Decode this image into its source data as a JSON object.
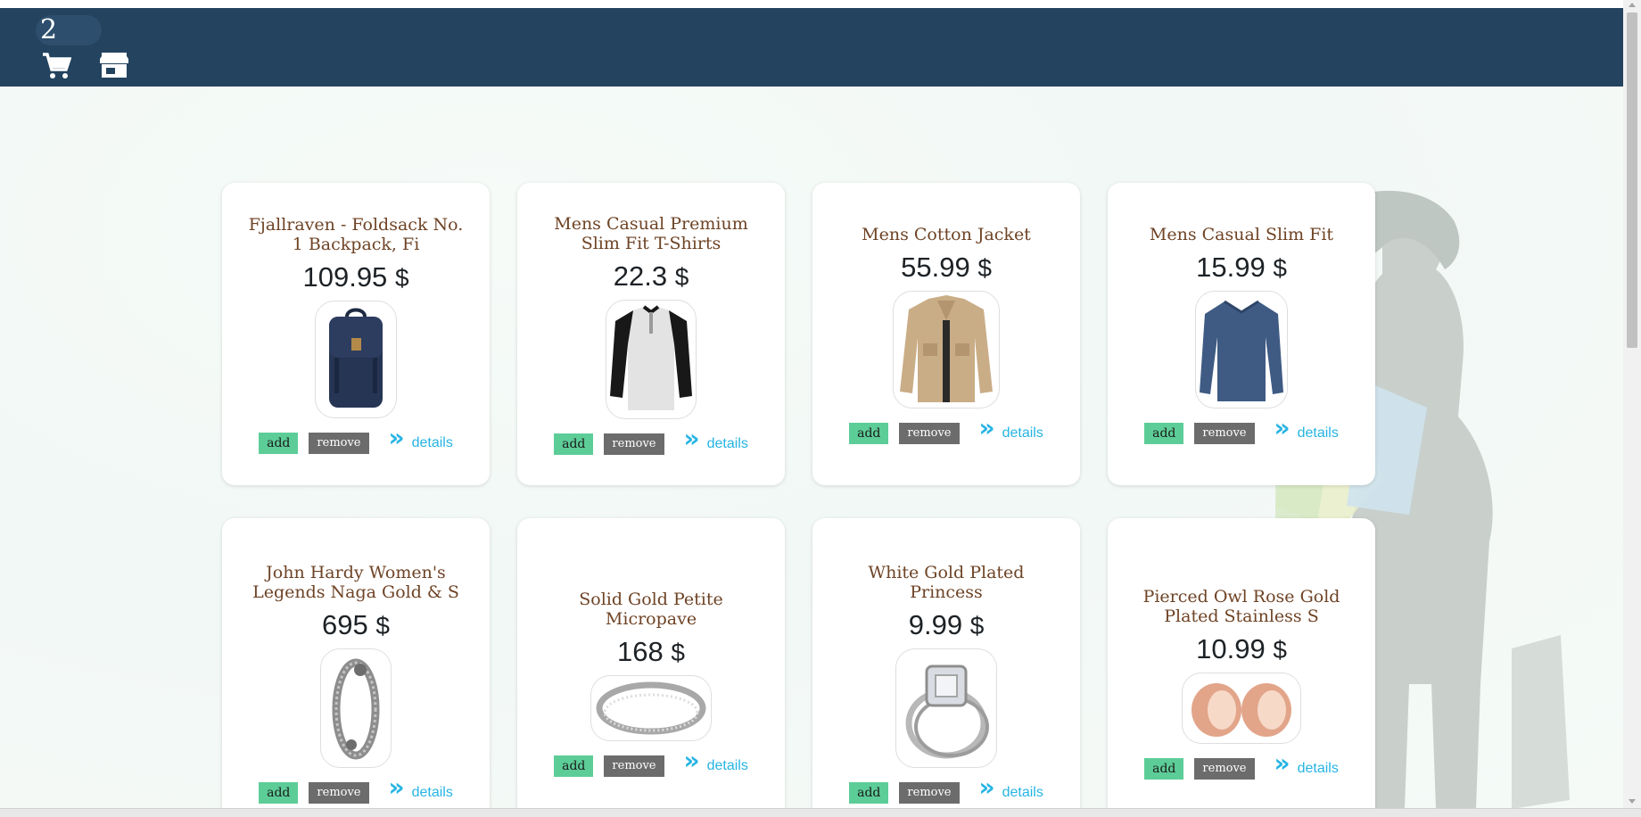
{
  "header": {
    "cart_count": "2",
    "cart_icon": "shopping-cart-icon",
    "store_icon": "storefront-icon",
    "background": "#23435f"
  },
  "colors": {
    "add_button": "#5dcd98",
    "remove_button": "#6c6c6c",
    "details_link": "#26b4e3",
    "title": "#6e4325"
  },
  "products": [
    {
      "title": "Fjallraven - Foldsack No. 1 Backpack, Fi",
      "price": "109.95",
      "currency": "$",
      "image": "backpack",
      "add": "add",
      "remove": "remove",
      "details": "details"
    },
    {
      "title": "Mens Casual Premium Slim Fit T-Shirts",
      "price": "22.3",
      "currency": "$",
      "image": "henley-shirt",
      "add": "add",
      "remove": "remove",
      "details": "details"
    },
    {
      "title": "Mens Cotton Jacket",
      "price": "55.99",
      "currency": "$",
      "image": "cotton-jacket",
      "add": "add",
      "remove": "remove",
      "details": "details"
    },
    {
      "title": "Mens Casual Slim Fit",
      "price": "15.99",
      "currency": "$",
      "image": "long-sleeve-shirt",
      "add": "add",
      "remove": "remove",
      "details": "details"
    },
    {
      "title": "John Hardy Women's Legends Naga Gold & S",
      "price": "695",
      "currency": "$",
      "image": "chain-bracelet",
      "add": "add",
      "remove": "remove",
      "details": "details"
    },
    {
      "title": "Solid Gold Petite Micropave",
      "price": "168",
      "currency": "$",
      "image": "silver-ring",
      "add": "add",
      "remove": "remove",
      "details": "details"
    },
    {
      "title": "White Gold Plated Princess",
      "price": "9.99",
      "currency": "$",
      "image": "diamond-ring",
      "add": "add",
      "remove": "remove",
      "details": "details"
    },
    {
      "title": "Pierced Owl Rose Gold Plated Stainless S",
      "price": "10.99",
      "currency": "$",
      "image": "rose-gold-plugs",
      "add": "add",
      "remove": "remove",
      "details": "details"
    }
  ]
}
